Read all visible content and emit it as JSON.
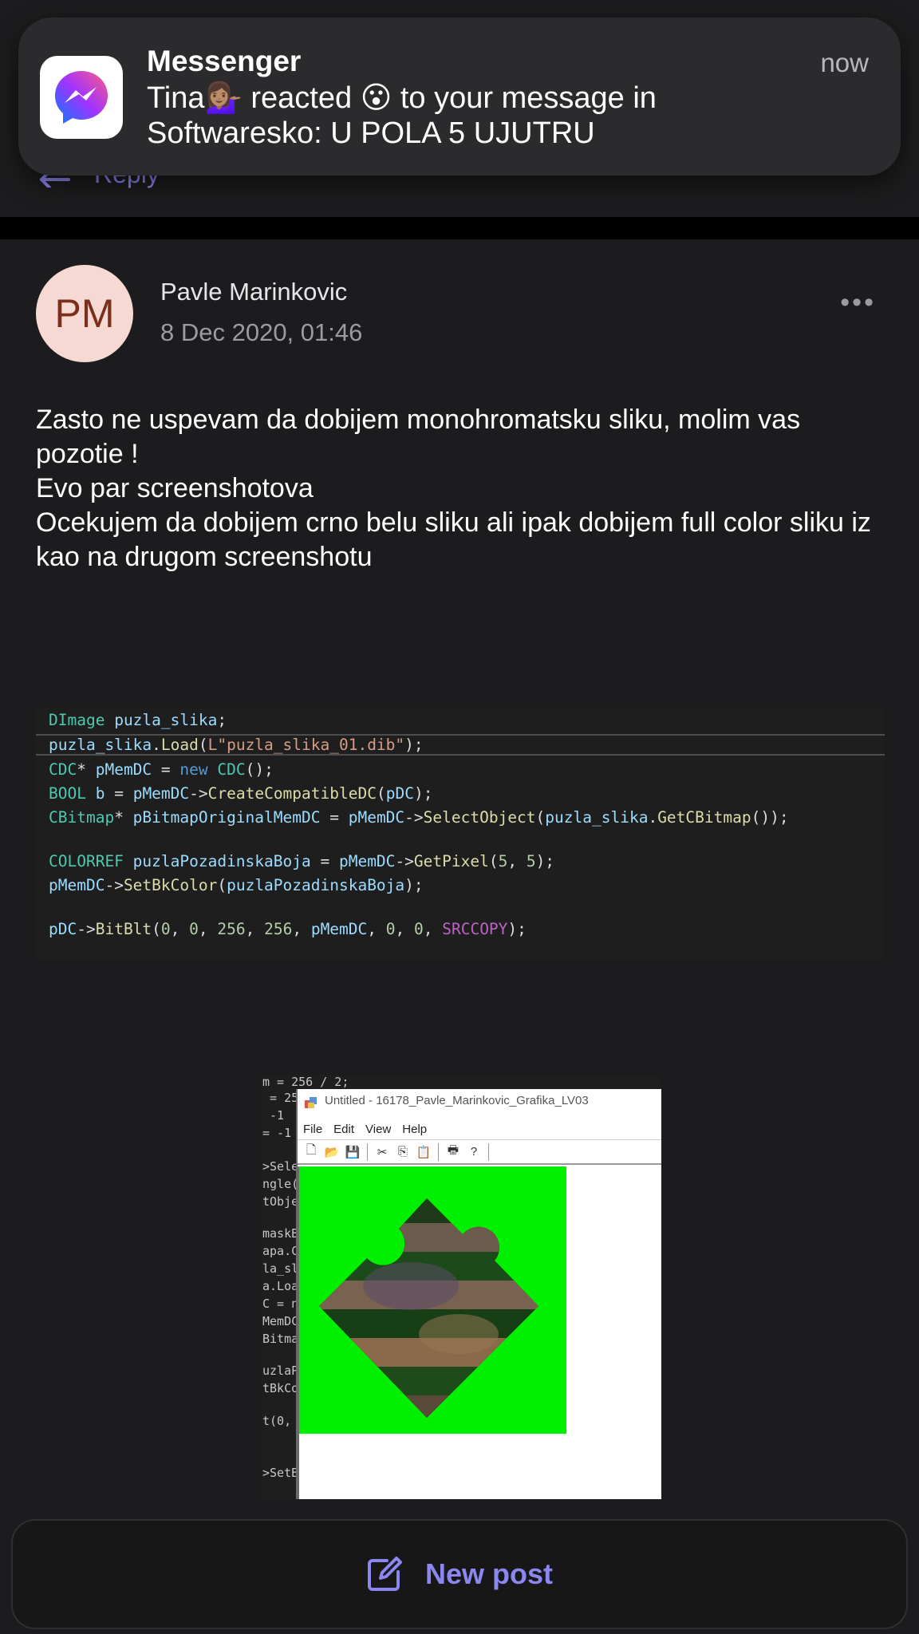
{
  "notification": {
    "app": "Messenger",
    "time": "now",
    "line1": "Tina💁🏽‍♀️ reacted 😮 to your message in",
    "line2": "Softwaresko: U POLA 5 UJUTRU",
    "icon": "messenger-icon"
  },
  "previous_post": {
    "reply_label": "Reply"
  },
  "post": {
    "avatar_initials": "PM",
    "author": "Pavle Marinkovic",
    "date": "8 Dec 2020, 01:46",
    "more_label": "•••",
    "text": [
      "Zasto ne uspevam da dobijem monohromatsku sliku, molim vas pozotie !",
      "Evo par screenshotova",
      "Ocekujem da dobijem crno belu sliku ali ipak dobijem full color sliku iz kao na drugom screenshotu"
    ],
    "code_image": {
      "lines": [
        "DImage puzla_slika;",
        "puzla_slika.Load(L\"puzla_slika_01.dib\");",
        "CDC* pMemDC = new CDC();",
        "BOOL b = pMemDC->CreateCompatibleDC(pDC);",
        "CBitmap* pBitmapOriginalMemDC = pMemDC->SelectObject(puzla_slika.GetCBitmap());",
        "COLORREF puzlaPozadinskaBoja = pMemDC->GetPixel(5, 5);",
        "pMemDC->SetBkColor(puzlaPozadinskaBoja);",
        "pDC->BitBlt(0, 0, 256, 256, pMemDC, 0, 0, SRCCOPY);"
      ]
    },
    "window_image": {
      "title": "Untitled - 16178_Pavle_Marinkovic_Grafika_LV03",
      "menu": [
        "File",
        "Edit",
        "View",
        "Help"
      ],
      "background_code": [
        "m = 256 / 2;",
        " = 25",
        " -1",
        "= -1",
        ">Sele",
        "ngle(",
        "tObje",
        "maskB",
        "apa.C",
        "la_sl",
        "a.Loa",
        "C = n",
        "MemDC",
        "Bitma",
        "uzlaP",
        "tBkCo",
        "t(0, ",
        ">SetB"
      ],
      "canvas_color": "#00f000"
    }
  },
  "bottom": {
    "new_post_label": "New post"
  },
  "colors": {
    "accent": "#8b86f0",
    "background": "#1c1c1e"
  }
}
